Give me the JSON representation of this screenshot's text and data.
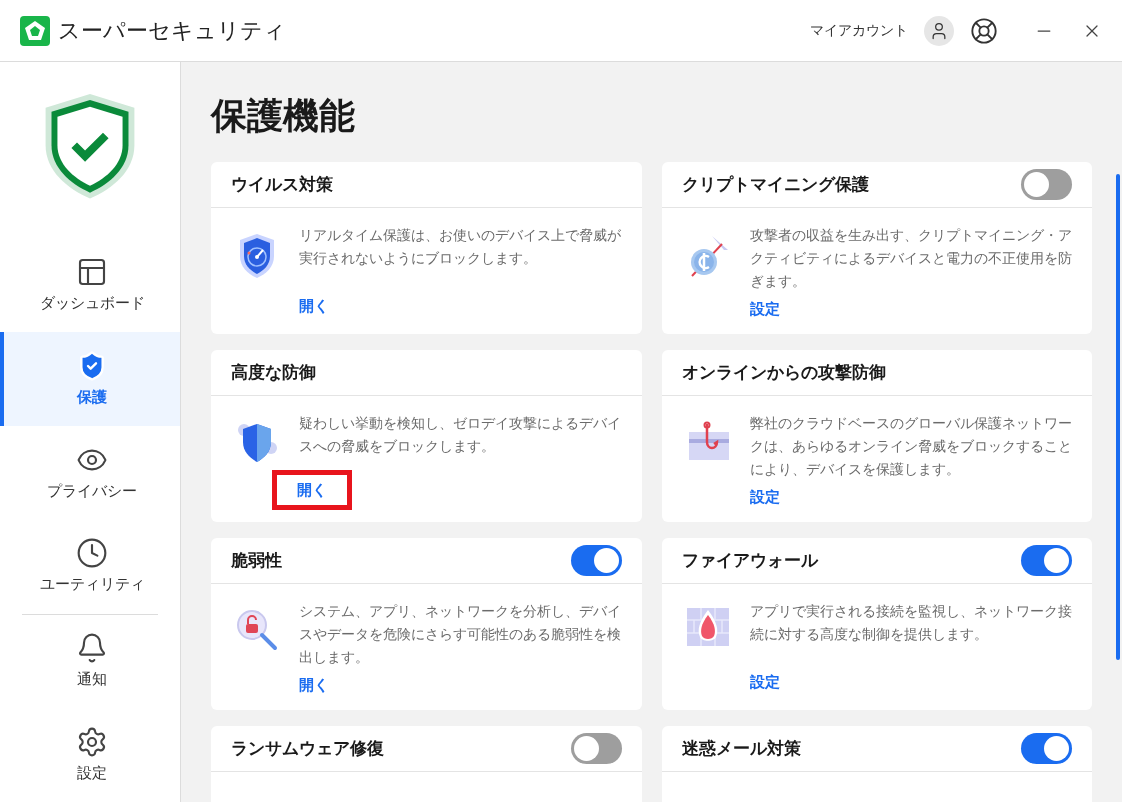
{
  "app": {
    "title": "スーパーセキュリティ",
    "account_label": "マイアカウント"
  },
  "sidebar": {
    "main_items": [
      {
        "kind": "dashboard",
        "label": "ダッシュボード",
        "selected": false
      },
      {
        "kind": "protection",
        "label": "保護",
        "selected": true
      },
      {
        "kind": "privacy",
        "label": "プライバシー",
        "selected": false
      },
      {
        "kind": "utility",
        "label": "ユーティリティ",
        "selected": false
      }
    ],
    "secondary_items": [
      {
        "kind": "notifications",
        "label": "通知",
        "selected": false
      },
      {
        "kind": "settings",
        "label": "設定",
        "selected": false
      }
    ]
  },
  "page_title": "保護機能",
  "cards": [
    {
      "kind": "virus",
      "title": "ウイルス対策",
      "description": "リアルタイム保護は、お使いのデバイス上で脅威が実行されないようにブロックします。",
      "link": {
        "label": "開く",
        "highlighted": false
      }
    },
    {
      "kind": "crypto",
      "title": "クリプトマイニング保護",
      "switch_on": false,
      "description": "攻撃者の収益を生み出す、クリプトマイニング・アクティビティによるデバイスと電力の不正使用を防ぎます。",
      "link": {
        "label": "設定",
        "highlighted": false
      }
    },
    {
      "kind": "advanced",
      "title": "高度な防御",
      "description": "疑わしい挙動を検知し、ゼロデイ攻撃によるデバイスへの脅威をブロックします。",
      "link": {
        "label": "開く",
        "highlighted": true
      }
    },
    {
      "kind": "online",
      "title": "オンラインからの攻撃防御",
      "description": "弊社のクラウドベースのグローバル保護ネットワークは、あらゆるオンライン脅威をブロックすることにより、デバイスを保護します。",
      "link": {
        "label": "設定",
        "highlighted": false
      }
    },
    {
      "kind": "vulnerability",
      "title": "脆弱性",
      "switch_on": true,
      "description": "システム、アプリ、ネットワークを分析し、デバイスやデータを危険にさらす可能性のある脆弱性を検出します。",
      "link": {
        "label": "開く",
        "highlighted": false
      }
    },
    {
      "kind": "firewall",
      "title": "ファイアウォール",
      "switch_on": true,
      "description": "アプリで実行される接続を監視し、ネットワーク接続に対する高度な制御を提供します。",
      "link": {
        "label": "設定",
        "highlighted": false
      }
    },
    {
      "title": "ランサムウェア修復",
      "switch_on": false
    },
    {
      "title": "迷惑メール対策",
      "switch_on": true
    }
  ]
}
